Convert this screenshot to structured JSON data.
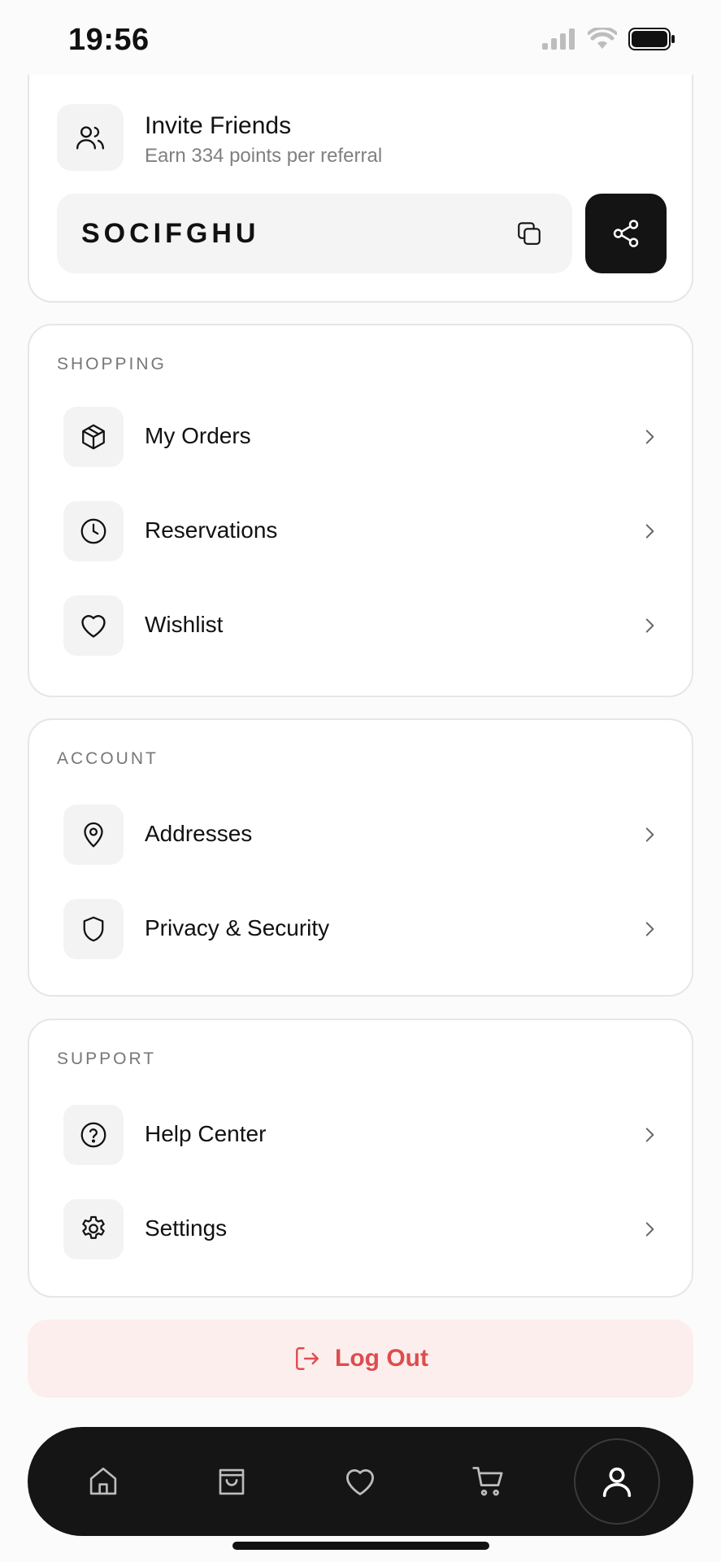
{
  "status_bar": {
    "time": "19:56"
  },
  "invite": {
    "title": "Invite Friends",
    "subtitle": "Earn 334 points per referral",
    "code": "SOCIFGHU"
  },
  "sections": {
    "shopping": {
      "label": "SHOPPING",
      "items": [
        {
          "label": "My Orders",
          "icon": "package-icon"
        },
        {
          "label": "Reservations",
          "icon": "clock-icon"
        },
        {
          "label": "Wishlist",
          "icon": "heart-icon"
        }
      ]
    },
    "account": {
      "label": "ACCOUNT",
      "items": [
        {
          "label": "Addresses",
          "icon": "map-pin-icon"
        },
        {
          "label": "Privacy & Security",
          "icon": "shield-icon"
        }
      ]
    },
    "support": {
      "label": "SUPPORT",
      "items": [
        {
          "label": "Help Center",
          "icon": "help-circle-icon"
        },
        {
          "label": "Settings",
          "icon": "gear-icon"
        }
      ]
    }
  },
  "logout": {
    "label": "Log Out",
    "color": "#dd4d4d"
  },
  "tabbar": {
    "tabs": [
      "home-icon",
      "shopping-bag-icon",
      "heart-icon",
      "cart-icon",
      "user-icon"
    ],
    "active": "user-icon"
  }
}
